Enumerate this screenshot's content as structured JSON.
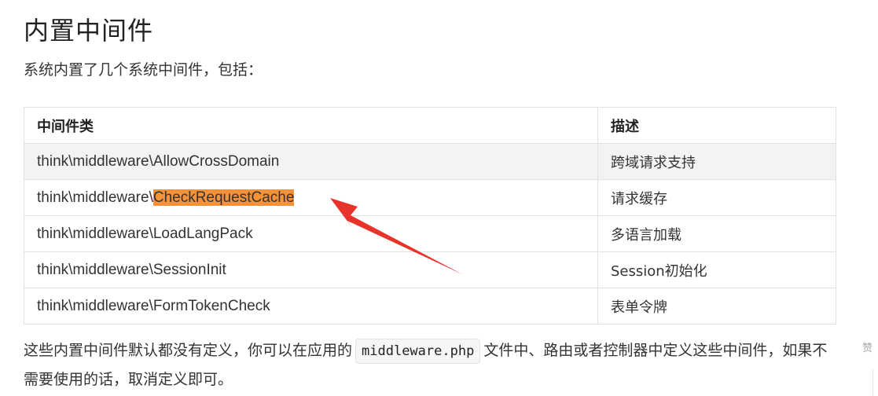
{
  "heading": "内置中间件",
  "intro": "系统内置了几个系统中间件，包括：",
  "table": {
    "headers": [
      "中间件类",
      "描述"
    ],
    "rows": [
      {
        "prefix": "think\\middleware\\AllowCrossDomain",
        "highlight": "",
        "desc": "跨域请求支持"
      },
      {
        "prefix": "think\\middleware\\",
        "highlight": "CheckRequestCache",
        "desc": "请求缓存"
      },
      {
        "prefix": "think\\middleware\\LoadLangPack",
        "highlight": "",
        "desc": "多语言加载"
      },
      {
        "prefix": "think\\middleware\\SessionInit",
        "highlight": "",
        "desc": "Session初始化"
      },
      {
        "prefix": "think\\middleware\\FormTokenCheck",
        "highlight": "",
        "desc": "表单令牌"
      }
    ]
  },
  "paragraph": {
    "before": "这些内置中间件默认都没有定义，你可以在应用的",
    "code": "middleware.php",
    "after": "文件中、路由或者控制器中定义这些中间件，如果不需要使用的话，取消定义即可。"
  },
  "side_label": "赞",
  "colors": {
    "highlight": "#f7923a",
    "arrow": "#e8332b",
    "border": "#dfe2e5",
    "shaded_row": "#f3f3f3"
  }
}
